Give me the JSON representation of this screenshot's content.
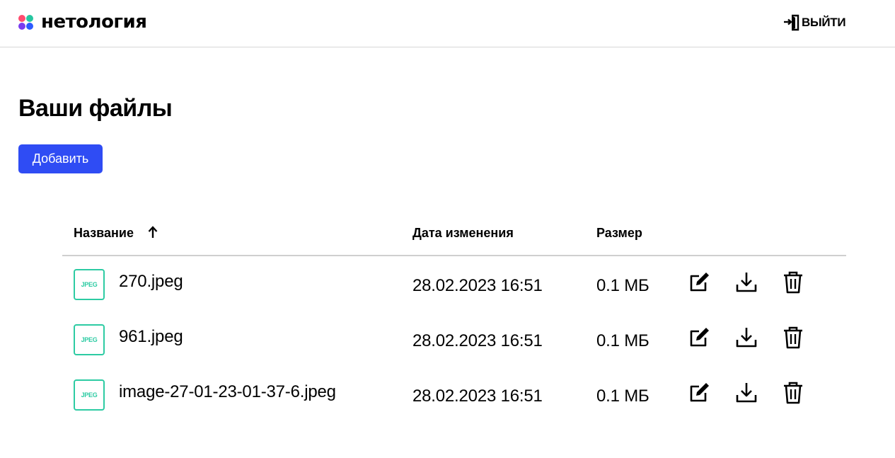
{
  "header": {
    "logo_text": "нетология",
    "logout_label": "ВЫЙТИ",
    "logo_colors": [
      "#ff4b6e",
      "#26c6a0",
      "#7a3cf0",
      "#2d5bff"
    ]
  },
  "main": {
    "title": "Ваши файлы",
    "add_label": "Добавить"
  },
  "table": {
    "columns": {
      "name": "Название",
      "date": "Дата изменения",
      "size": "Размер"
    },
    "sort_icon": "arrow-up-icon",
    "rows": [
      {
        "type_label": "JPEG",
        "name": "270.jpeg",
        "date": "28.02.2023 16:51",
        "size": "0.1 МБ"
      },
      {
        "type_label": "JPEG",
        "name": "961.jpeg",
        "date": "28.02.2023 16:51",
        "size": "0.1 МБ"
      },
      {
        "type_label": "JPEG",
        "name": "image-27-01-23-01-37-6.jpeg",
        "date": "28.02.2023 16:51",
        "size": "0.1 МБ"
      }
    ],
    "row_actions": [
      "edit-icon",
      "download-icon",
      "trash-icon"
    ]
  },
  "colors": {
    "accent": "#2f4cf4",
    "file_icon": "#2dcba3",
    "divider": "#cfcfcf"
  }
}
